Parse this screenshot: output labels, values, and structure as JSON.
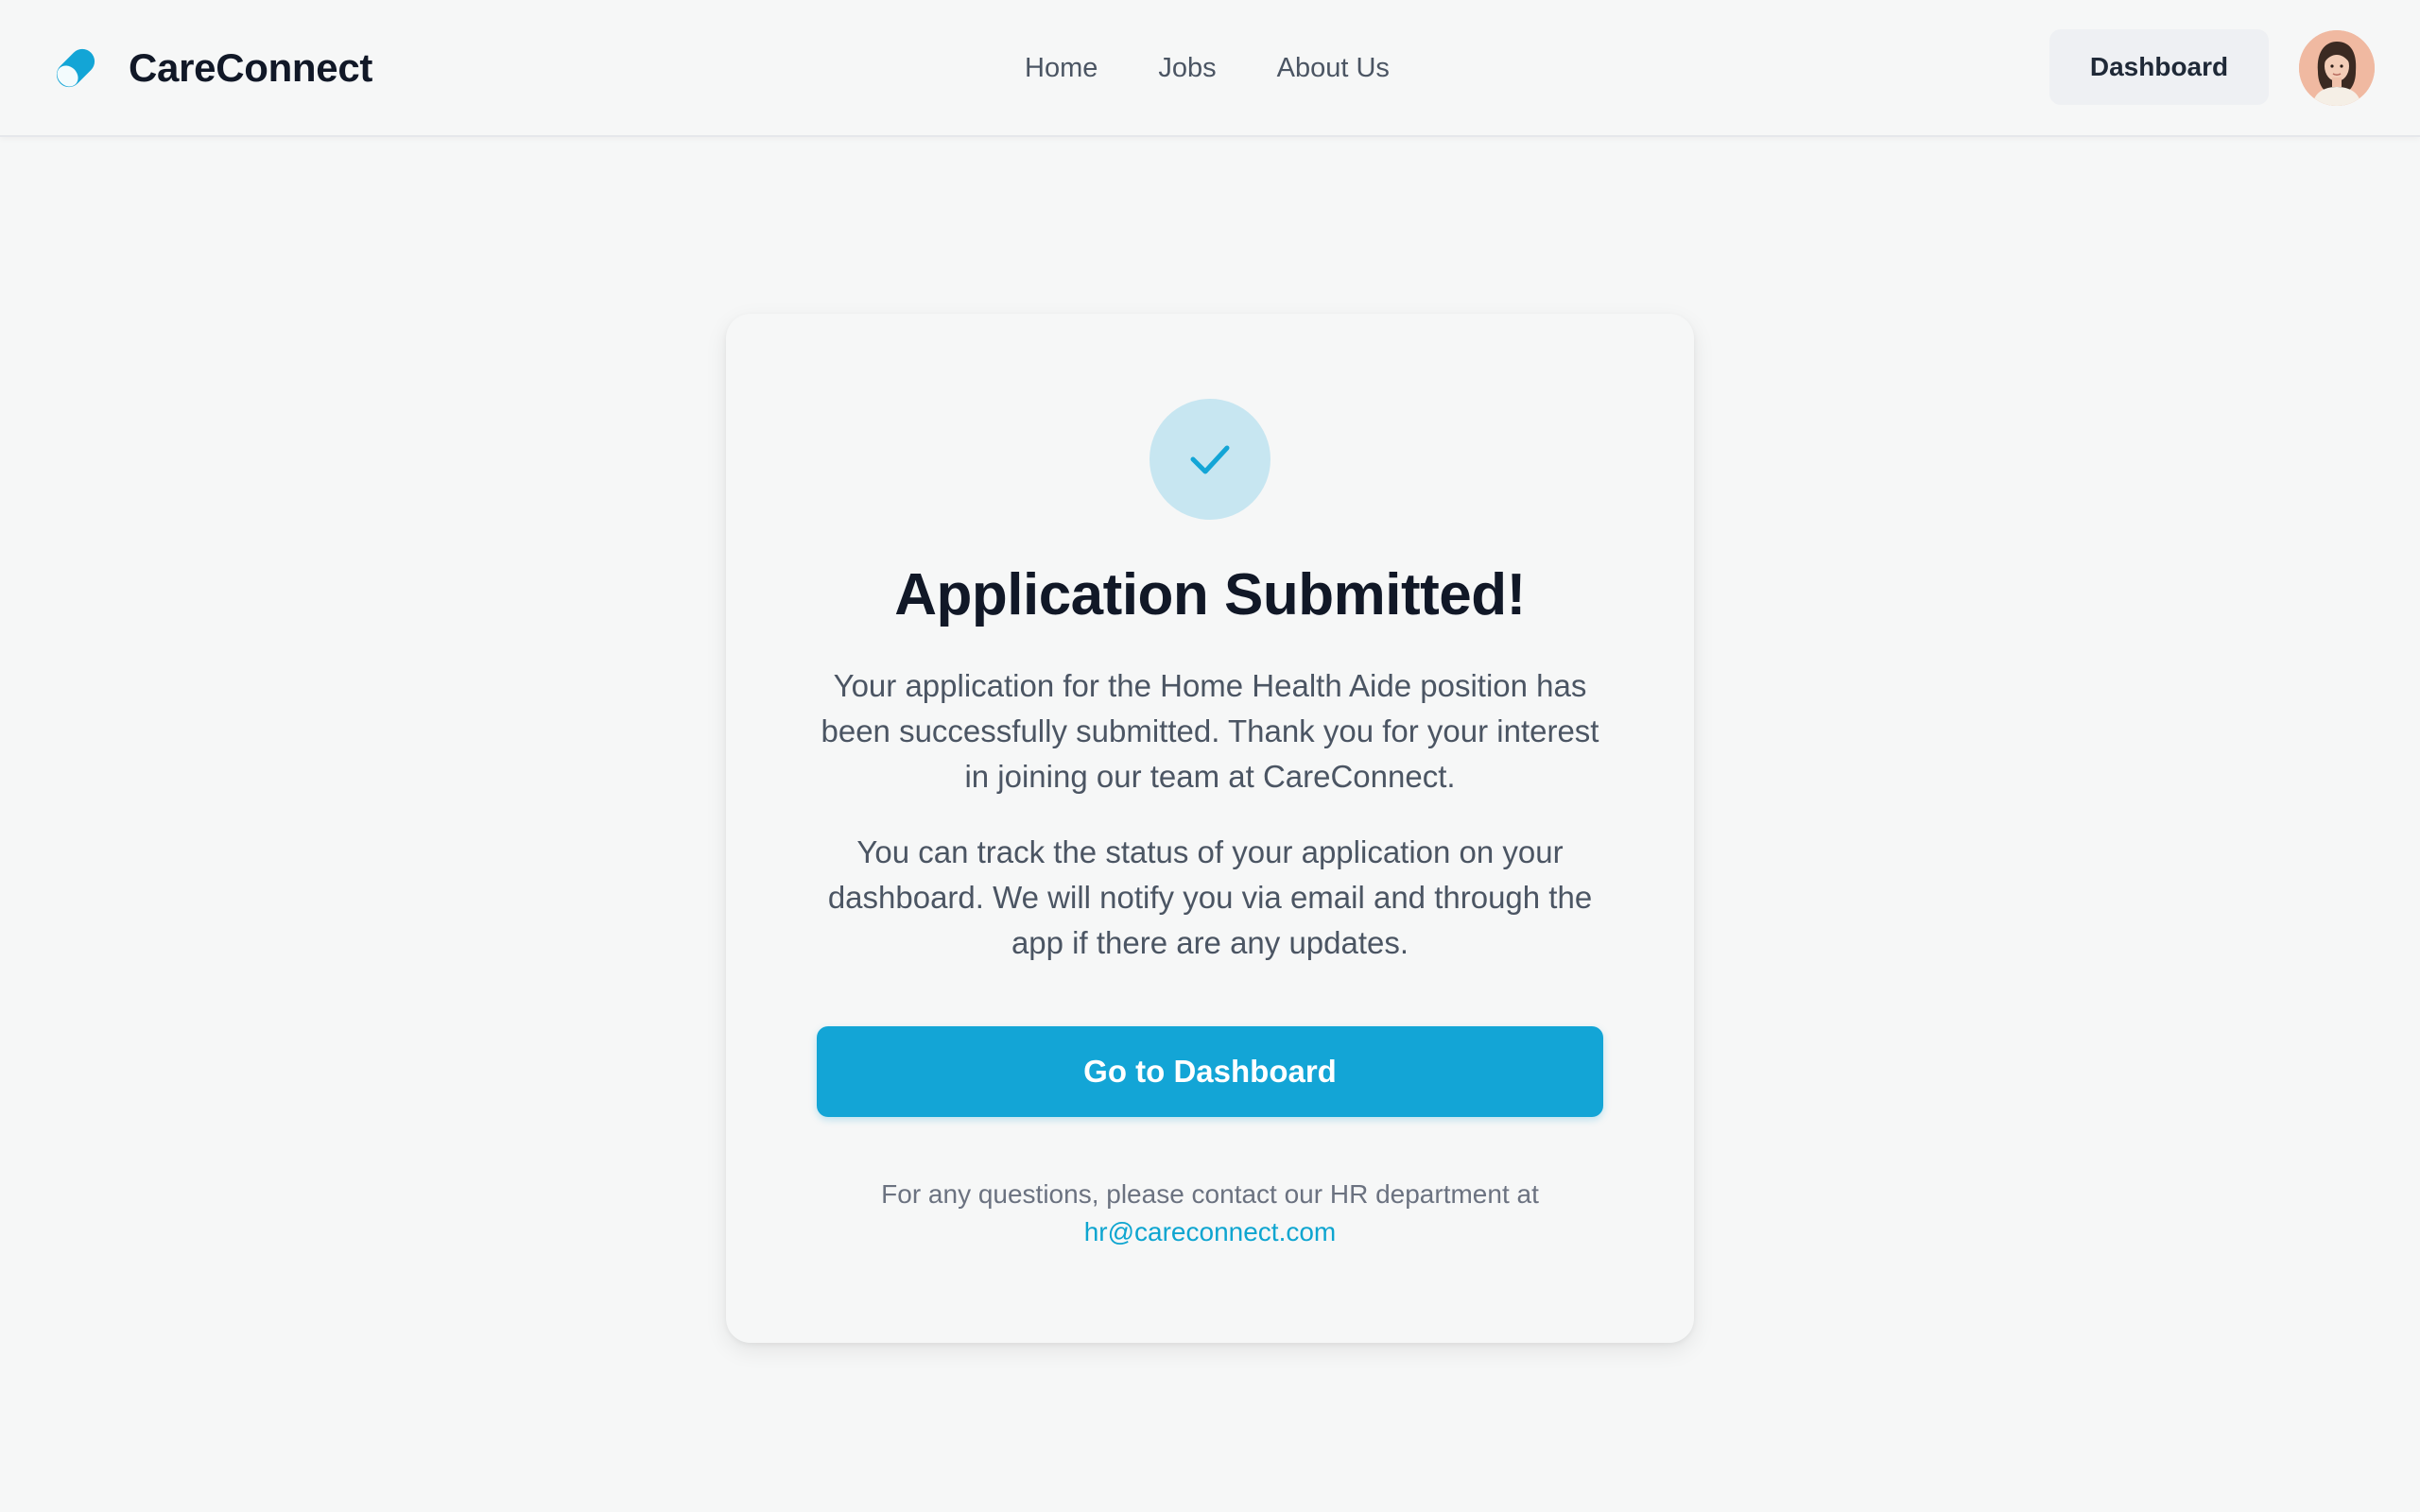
{
  "header": {
    "brand_name": "CareConnect",
    "nav": [
      {
        "label": "Home"
      },
      {
        "label": "Jobs"
      },
      {
        "label": "About Us"
      }
    ],
    "dashboard_button": "Dashboard",
    "avatar_icon": "user-avatar"
  },
  "card": {
    "icon": "check-icon",
    "title": "Application Submitted!",
    "message_1": "Your application for the Home Health Aide position has been successfully submitted. Thank you for your interest in joining our team at CareConnect.",
    "message_2": "You can track the status of your application on your dashboard. We will notify you via email and through the app if there are any updates.",
    "cta_label": "Go to Dashboard",
    "contact_text": "For any questions, please contact our HR department at",
    "contact_email": "hr@careconnect.com"
  },
  "colors": {
    "accent": "#13a5d6",
    "background": "#f6f7f7",
    "check_bg": "#c7e6f1",
    "text_primary": "#111827",
    "text_secondary": "#4b5563"
  }
}
